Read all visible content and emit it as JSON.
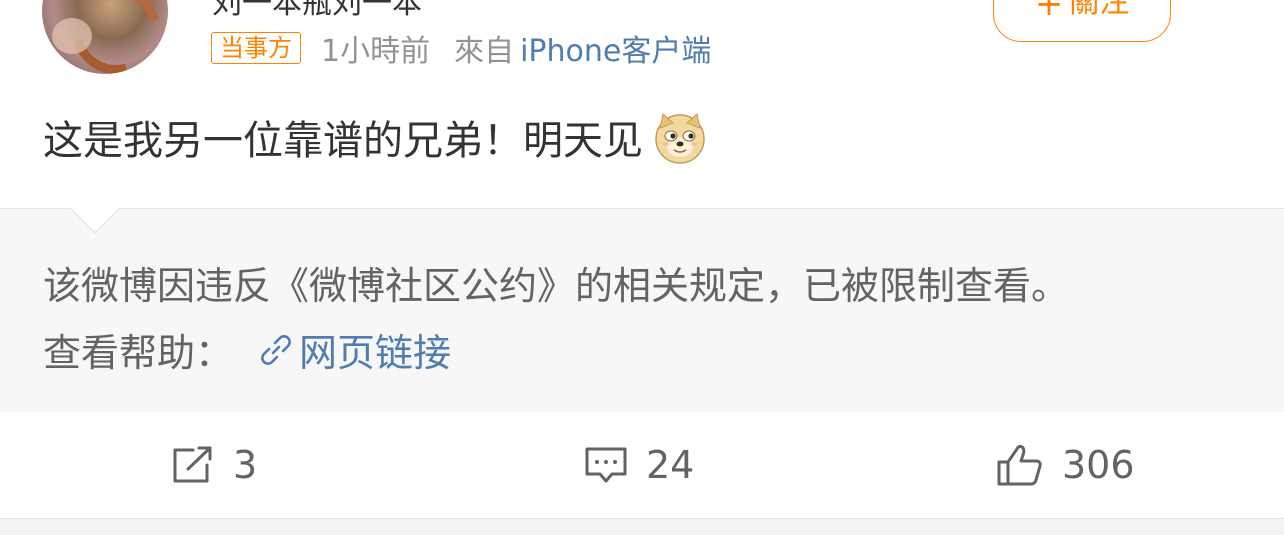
{
  "post": {
    "author_name": "刘一本瓶刘一本",
    "badge": "当事方",
    "time": "1小時前",
    "source_prefix": "來自",
    "source": "iPhone客户端",
    "follow_label": "關注",
    "text": "这是我另一位靠谱的兄弟！明天见",
    "emoji": "doge-emoji"
  },
  "notice": {
    "message": "该微博因违反《微博社区公约》的相关规定，已被限制查看。",
    "help_label": "查看帮助：",
    "link_label": "网页链接",
    "link_icon": "link-icon"
  },
  "actions": {
    "repost": {
      "icon": "repost-icon",
      "count": "3"
    },
    "comment": {
      "icon": "comment-icon",
      "count": "24"
    },
    "like": {
      "icon": "like-icon",
      "count": "306"
    }
  },
  "colors": {
    "accent": "#ff8200",
    "link": "#507daf",
    "muted": "#939393",
    "notice_bg": "#f7f7f7"
  }
}
